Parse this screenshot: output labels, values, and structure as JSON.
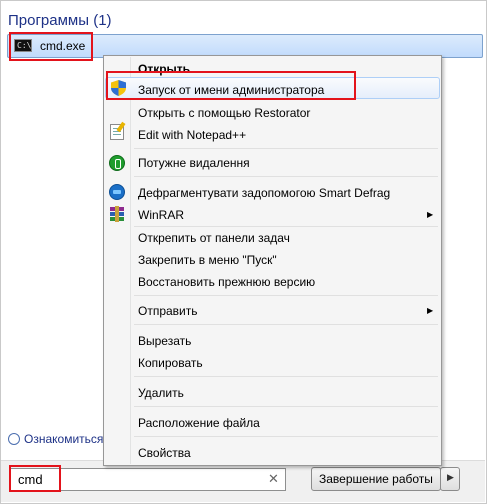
{
  "start_menu": {
    "programs_header": "Программы (1)",
    "result": {
      "label": "cmd.exe",
      "icon": "cmd-console-icon",
      "icon_text": "C:\\"
    },
    "learn_more_link": "Ознакомиться"
  },
  "search": {
    "value": "cmd",
    "clear_symbol": "✕"
  },
  "shutdown": {
    "label": "Завершение работы",
    "arrow": "▶"
  },
  "context_menu": {
    "items": [
      {
        "label": "Открыть",
        "bold": true
      },
      {
        "label": "Запуск от имени администратора",
        "icon": "uac-shield-icon",
        "highlighted": true
      },
      {
        "label": "Открыть с помощью Restorator"
      },
      {
        "label": "Edit with Notepad++",
        "icon": "notepad-plus-plus-icon"
      },
      {
        "label": "Потужне видалення",
        "icon": "power-uninstall-icon"
      },
      {
        "label": "Дефрагментувати задопомогою Smart Defrag",
        "icon": "smart-defrag-icon"
      },
      {
        "label": "WinRAR",
        "icon": "winrar-icon",
        "submenu": true
      },
      {
        "label": "Открепить от панели задач"
      },
      {
        "label": "Закрепить в меню \"Пуск\""
      },
      {
        "label": "Восстановить прежнюю версию"
      },
      {
        "label": "Отправить",
        "submenu": true
      },
      {
        "label": "Вырезать"
      },
      {
        "label": "Копировать"
      },
      {
        "label": "Удалить"
      },
      {
        "label": "Расположение файла"
      },
      {
        "label": "Свойства"
      }
    ],
    "submenu_arrow": "▶"
  },
  "colors": {
    "accent_red": "#e3131b",
    "header_blue": "#1e3287",
    "highlight_border": "#aecff7"
  }
}
